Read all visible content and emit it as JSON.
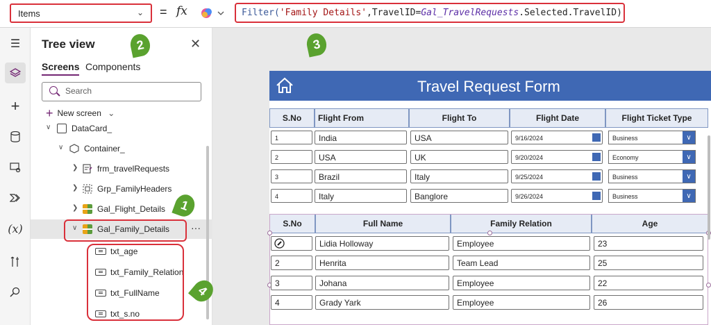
{
  "formula_bar": {
    "property": "Items",
    "equals": "=",
    "fx": "fx",
    "formula_parts": [
      {
        "text": "Filter(",
        "kind": "fn"
      },
      {
        "text": "'Family Details'",
        "kind": "str"
      },
      {
        "text": ",TravelID=",
        "kind": "plain"
      },
      {
        "text": "Gal_TravelRequests",
        "kind": "id"
      },
      {
        "text": ".Selected.TravelID)",
        "kind": "plain"
      }
    ]
  },
  "tree_view": {
    "title": "Tree view",
    "tabs": [
      "Screens",
      "Components"
    ],
    "search_placeholder": "Search",
    "new_screen": "New screen",
    "items": [
      {
        "label": "DataCard_"
      },
      {
        "label": "Container_"
      },
      {
        "label": "frm_travelRequests"
      },
      {
        "label": "Grp_FamilyHeaders"
      },
      {
        "label": "Gal_Flight_Details"
      },
      {
        "label": "Gal_Family_Details"
      },
      {
        "label": "txt_age"
      },
      {
        "label": "txt_Family_Relation"
      },
      {
        "label": "txt_FullName"
      },
      {
        "label": "txt_s.no"
      }
    ],
    "more": "···"
  },
  "annotations": [
    "1",
    "2",
    "3",
    "4"
  ],
  "form": {
    "title": "Travel Request Form",
    "flight_headers": [
      "S.No",
      "Flight From",
      "Flight To",
      "Flight Date",
      "Flight Ticket Type"
    ],
    "flights": [
      {
        "sno": "1",
        "from": "India",
        "to": "USA",
        "date": "9/16/2024",
        "type": "Business"
      },
      {
        "sno": "2",
        "from": "USA",
        "to": "UK",
        "date": "9/20/2024",
        "type": "Economy"
      },
      {
        "sno": "3",
        "from": "Brazil",
        "to": "Italy",
        "date": "9/25/2024",
        "type": "Business"
      },
      {
        "sno": "4",
        "from": "Italy",
        "to": "Banglore",
        "date": "9/26/2024",
        "type": "Business"
      }
    ],
    "family_headers": [
      "S.No",
      "Full Name",
      "Family Relation",
      "Age"
    ],
    "family": [
      {
        "sno": "",
        "name": "Lidia Holloway",
        "relation": "Employee",
        "age": "23"
      },
      {
        "sno": "2",
        "name": "Henrita",
        "relation": "Team Lead",
        "age": "25"
      },
      {
        "sno": "3",
        "name": "Johana",
        "relation": "Employee",
        "age": "22"
      },
      {
        "sno": "4",
        "name": "Grady Yark",
        "relation": "Employee",
        "age": "26"
      }
    ]
  },
  "colors": {
    "accent_red": "#d9303a",
    "form_blue": "#3f68b4",
    "badge_green": "#5aa22f",
    "brand_purple": "#742774"
  }
}
